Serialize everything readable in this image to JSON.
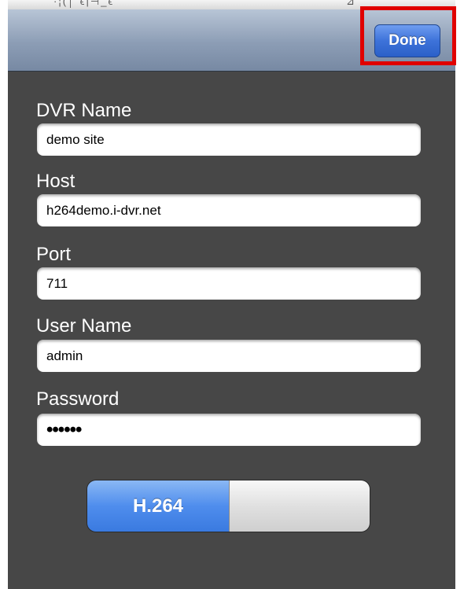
{
  "statusbar": {
    "fragment_left": "·¦(│ ϵ|⊣_ϵ",
    "fragment_right": "⊿"
  },
  "navbar": {
    "done_label": "Done"
  },
  "form": {
    "fields": [
      {
        "label": "DVR Name",
        "value": "demo site"
      },
      {
        "label": "Host",
        "value": "h264demo.i-dvr.net"
      },
      {
        "label": "Port",
        "value": "711"
      },
      {
        "label": "User Name",
        "value": "admin"
      },
      {
        "label": "Password",
        "value": "••••••"
      }
    ]
  },
  "codec_toggle": {
    "on_label": "H.264",
    "state": "on"
  },
  "colors": {
    "background": "#474747",
    "accent_blue": "#3d72d9",
    "highlight_red": "#e00000"
  }
}
